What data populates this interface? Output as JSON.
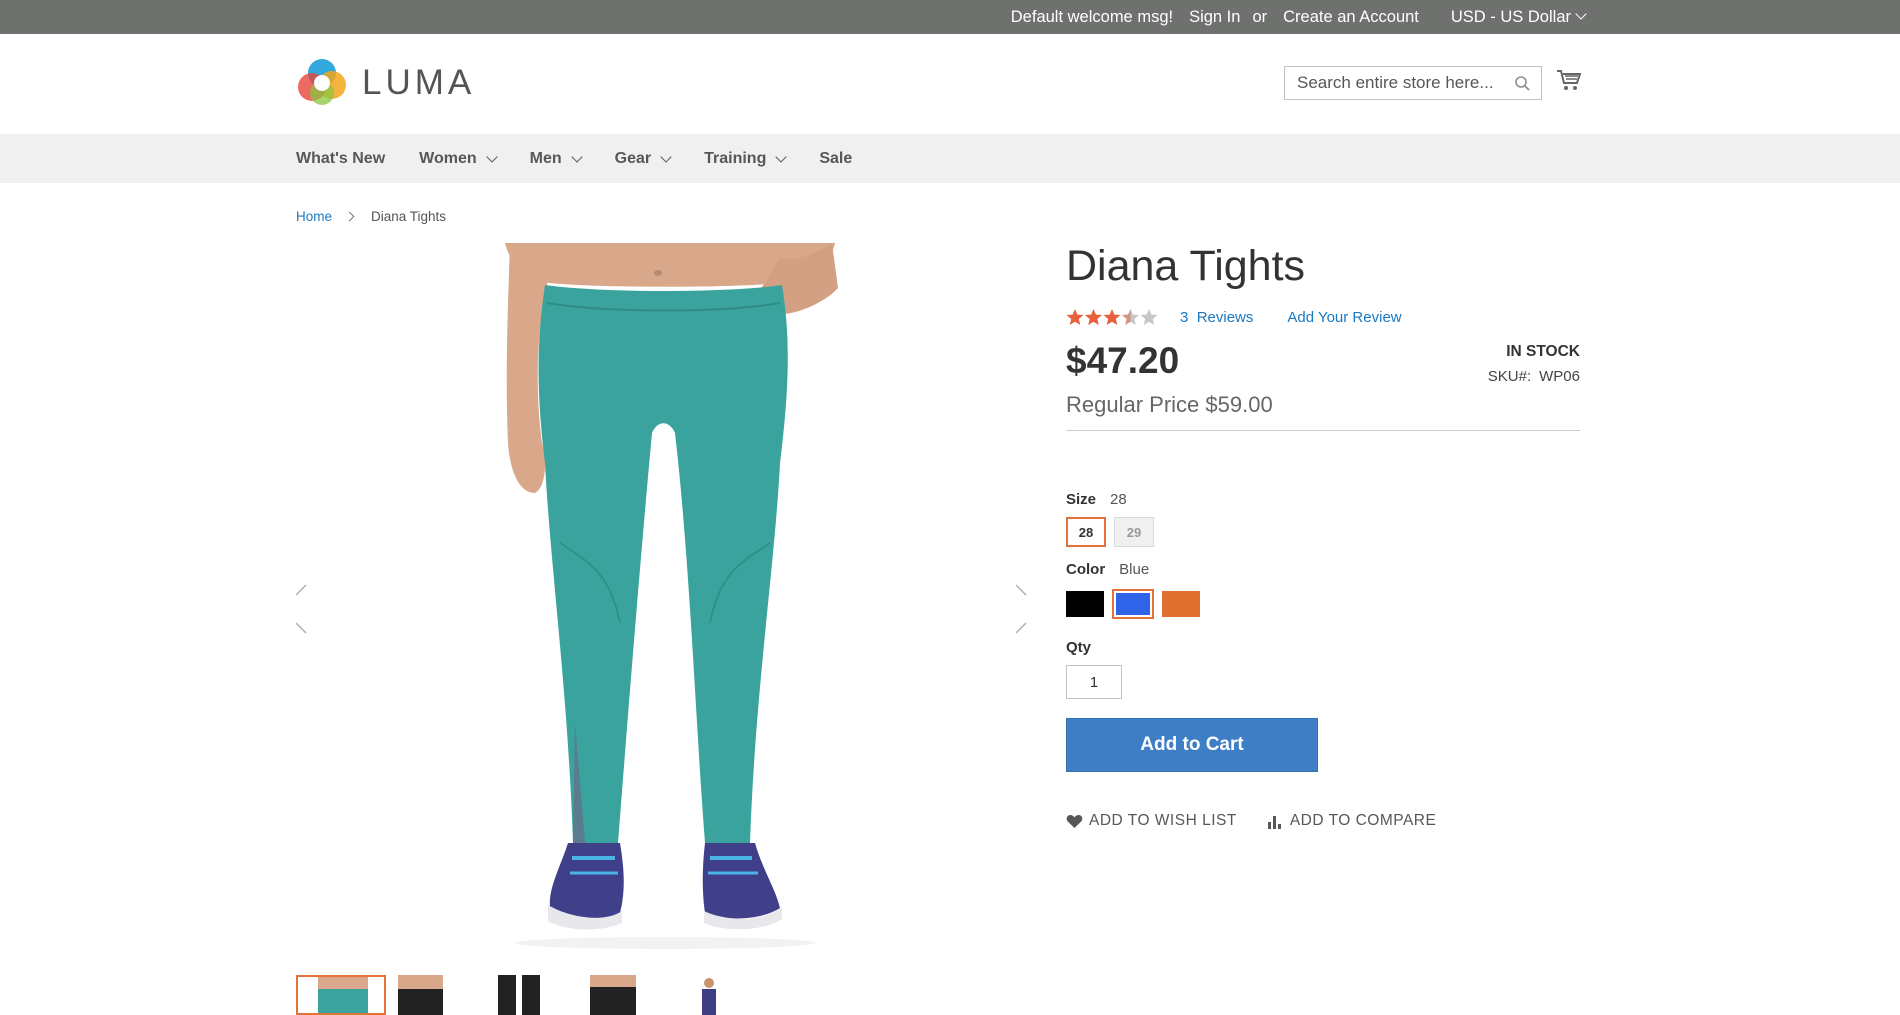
{
  "topbar": {
    "welcome": "Default welcome msg!",
    "sign_in": "Sign In",
    "or": "or",
    "create_account": "Create an Account",
    "currency": "USD - US Dollar"
  },
  "header": {
    "logo_text": "LUMA",
    "search_placeholder": "Search entire store here...",
    "icons": [
      "search-icon",
      "cart-icon"
    ]
  },
  "nav": {
    "items": [
      {
        "label": "What's New",
        "dropdown": false
      },
      {
        "label": "Women",
        "dropdown": true
      },
      {
        "label": "Men",
        "dropdown": true
      },
      {
        "label": "Gear",
        "dropdown": true
      },
      {
        "label": "Training",
        "dropdown": true
      },
      {
        "label": "Sale",
        "dropdown": false
      }
    ]
  },
  "breadcrumb": {
    "home": "Home",
    "current": "Diana Tights"
  },
  "product": {
    "title": "Diana Tights",
    "rating_value": 3,
    "rating_max": 5,
    "reviews_count": "3",
    "reviews_label": "Reviews",
    "add_review": "Add Your Review",
    "price": "$47.20",
    "regular_price": "Regular Price $59.00",
    "stock": "IN STOCK",
    "sku_label": "SKU#:",
    "sku": "WP06"
  },
  "options": {
    "size_label": "Size",
    "size_selected": "28",
    "sizes": [
      "28",
      "29"
    ],
    "color_label": "Color",
    "color_selected": "Blue",
    "colors": [
      {
        "name": "Black",
        "hex": "#000000"
      },
      {
        "name": "Blue",
        "hex": "#2f63e8"
      },
      {
        "name": "Orange",
        "hex": "#e07030"
      }
    ],
    "qty_label": "Qty",
    "qty_value": "1"
  },
  "actions": {
    "add_to_cart": "Add to Cart",
    "wish_list": "ADD TO WISH LIST",
    "compare": "ADD TO COMPARE"
  },
  "colors": {
    "accent": "#e2723b",
    "primary_button": "#3d7ec5",
    "link": "#1979c3",
    "topbar": "#6e716e",
    "product_teal": "#3aa39e"
  }
}
